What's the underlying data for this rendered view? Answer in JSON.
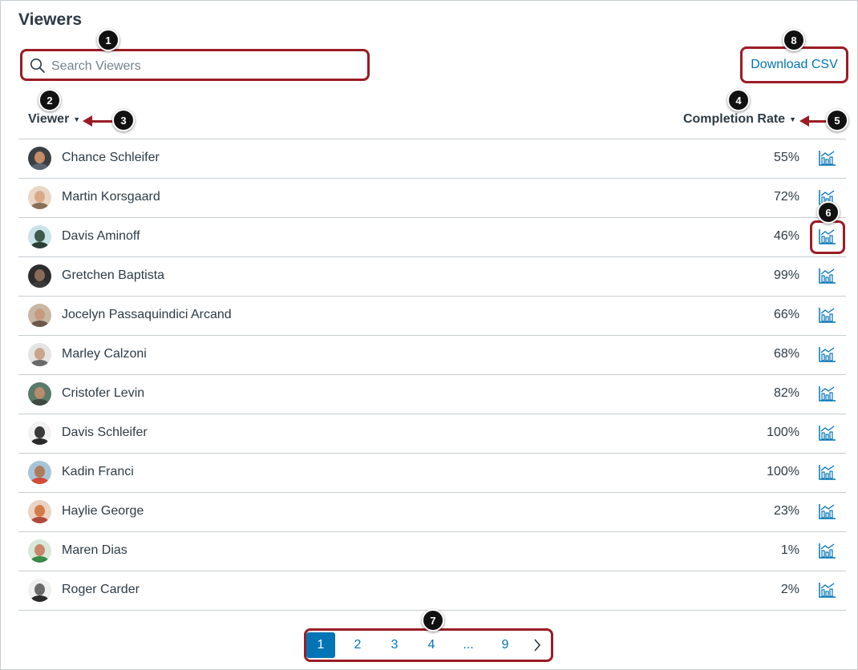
{
  "page": {
    "title": "Viewers"
  },
  "search": {
    "placeholder": "Search Viewers",
    "value": ""
  },
  "download_csv_label": "Download CSV",
  "columns": {
    "viewer": "Viewer",
    "completion_rate": "Completion Rate",
    "sort_icon": "sort-down-caret"
  },
  "rows": [
    {
      "name": "Chance Schleifer",
      "rate": "55%"
    },
    {
      "name": "Martin Korsgaard",
      "rate": "72%"
    },
    {
      "name": "Davis Aminoff",
      "rate": "46%"
    },
    {
      "name": "Gretchen Baptista",
      "rate": "99%"
    },
    {
      "name": "Jocelyn Passaquindici Arcand",
      "rate": "66%"
    },
    {
      "name": "Marley Calzoni",
      "rate": "68%"
    },
    {
      "name": "Cristofer Levin",
      "rate": "82%"
    },
    {
      "name": "Davis Schleifer",
      "rate": "100%"
    },
    {
      "name": "Kadin Franci",
      "rate": "100%"
    },
    {
      "name": "Haylie George",
      "rate": "23%"
    },
    {
      "name": "Maren Dias",
      "rate": "1%"
    },
    {
      "name": "Roger Carder",
      "rate": "2%"
    }
  ],
  "row_action_icon": "analytics-chart-icon",
  "pagination": {
    "pages": [
      "1",
      "2",
      "3",
      "4",
      "...",
      "9"
    ],
    "current": "1",
    "next_icon": "chevron-right-icon"
  },
  "callouts": [
    "1",
    "2",
    "3",
    "4",
    "5",
    "6",
    "7",
    "8"
  ],
  "colors": {
    "accent": "#0374b5",
    "highlight": "#9b1c25",
    "text": "#2d3b45",
    "divider": "#c7cdd1"
  }
}
